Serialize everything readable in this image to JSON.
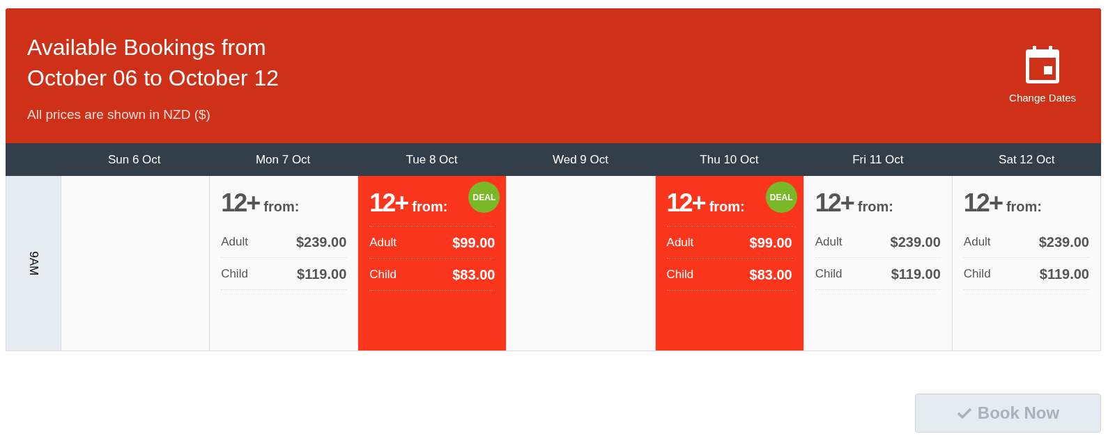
{
  "header": {
    "title_line_1": "Available Bookings from",
    "title_line_2": "October 06 to October 12",
    "subtitle": "All prices are shown in NZD ($)",
    "change_dates": "Change Dates"
  },
  "days": [
    "Sun 6 Oct",
    "Mon 7 Oct",
    "Tue 8 Oct",
    "Wed 9 Oct",
    "Thu 10 Oct",
    "Fri 11 Oct",
    "Sat 12 Oct"
  ],
  "time_slot": "9AM",
  "cells": [
    {
      "kind": "empty"
    },
    {
      "kind": "offer",
      "deal": false,
      "age": "12+",
      "from": "from:",
      "prices": [
        {
          "label": "Adult",
          "price": "$239.00"
        },
        {
          "label": "Child",
          "price": "$119.00"
        }
      ]
    },
    {
      "kind": "offer",
      "deal": true,
      "deal_label": "DEAL",
      "age": "12+",
      "from": "from:",
      "prices": [
        {
          "label": "Adult",
          "price": "$99.00"
        },
        {
          "label": "Child",
          "price": "$83.00"
        }
      ]
    },
    {
      "kind": "empty"
    },
    {
      "kind": "offer",
      "deal": true,
      "deal_label": "DEAL",
      "age": "12+",
      "from": "from:",
      "prices": [
        {
          "label": "Adult",
          "price": "$99.00"
        },
        {
          "label": "Child",
          "price": "$83.00"
        }
      ]
    },
    {
      "kind": "offer",
      "deal": false,
      "age": "12+",
      "from": "from:",
      "prices": [
        {
          "label": "Adult",
          "price": "$239.00"
        },
        {
          "label": "Child",
          "price": "$119.00"
        }
      ]
    },
    {
      "kind": "offer",
      "deal": false,
      "age": "12+",
      "from": "from:",
      "prices": [
        {
          "label": "Adult",
          "price": "$239.00"
        },
        {
          "label": "Child",
          "price": "$119.00"
        }
      ]
    }
  ],
  "book_button": {
    "label": "Book Now",
    "disabled": true
  }
}
